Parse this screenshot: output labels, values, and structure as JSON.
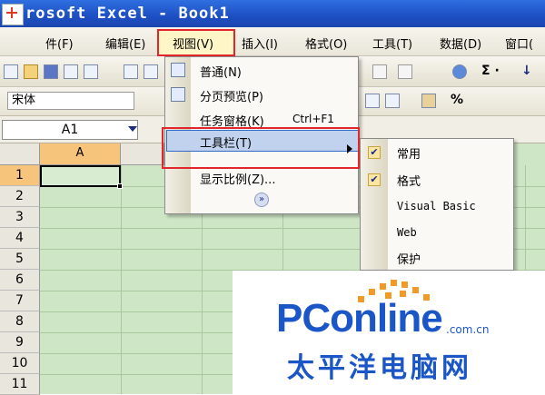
{
  "window": {
    "title": "rosoft Excel - Book1"
  },
  "menubar": {
    "items": [
      "件(F)",
      "编辑(E)",
      "视图(V)",
      "插入(I)",
      "格式(O)",
      "工具(T)",
      "数据(D)",
      "窗口("
    ]
  },
  "toolbar": {
    "sigma": "Σ ·",
    "fill_arrow": "↓"
  },
  "formatbar": {
    "font_name": "宋体",
    "percent": "%"
  },
  "namebox": {
    "value": "A1"
  },
  "columns": [
    "A"
  ],
  "rows": [
    "1",
    "2",
    "3",
    "4",
    "5",
    "6",
    "7",
    "8",
    "9",
    "10",
    "11"
  ],
  "view_menu": {
    "items": [
      {
        "label": "普通(N)"
      },
      {
        "label": "分页预览(P)"
      },
      {
        "label": "任务窗格(K)",
        "shortcut": "Ctrl+F1"
      },
      {
        "label": "工具栏(T)"
      },
      {
        "label": "显示比例(Z)..."
      }
    ],
    "more": "»"
  },
  "toolbars_submenu": {
    "items": [
      {
        "label": "常用",
        "checked": true
      },
      {
        "label": "格式",
        "checked": true
      },
      {
        "label": "Visual Basic",
        "checked": false
      },
      {
        "label": "Web",
        "checked": false
      },
      {
        "label": "保护",
        "checked": false
      }
    ],
    "check_glyph": "✔"
  },
  "watermark": {
    "brand": "PConline",
    "domain": ".com.cn",
    "chinese": "太平洋电脑网"
  },
  "colors": {
    "highlight_box": "#e2262c",
    "grid_bg": "#cfe6c6",
    "brand_blue": "#1a56c8",
    "brand_orange": "#f29a27"
  }
}
